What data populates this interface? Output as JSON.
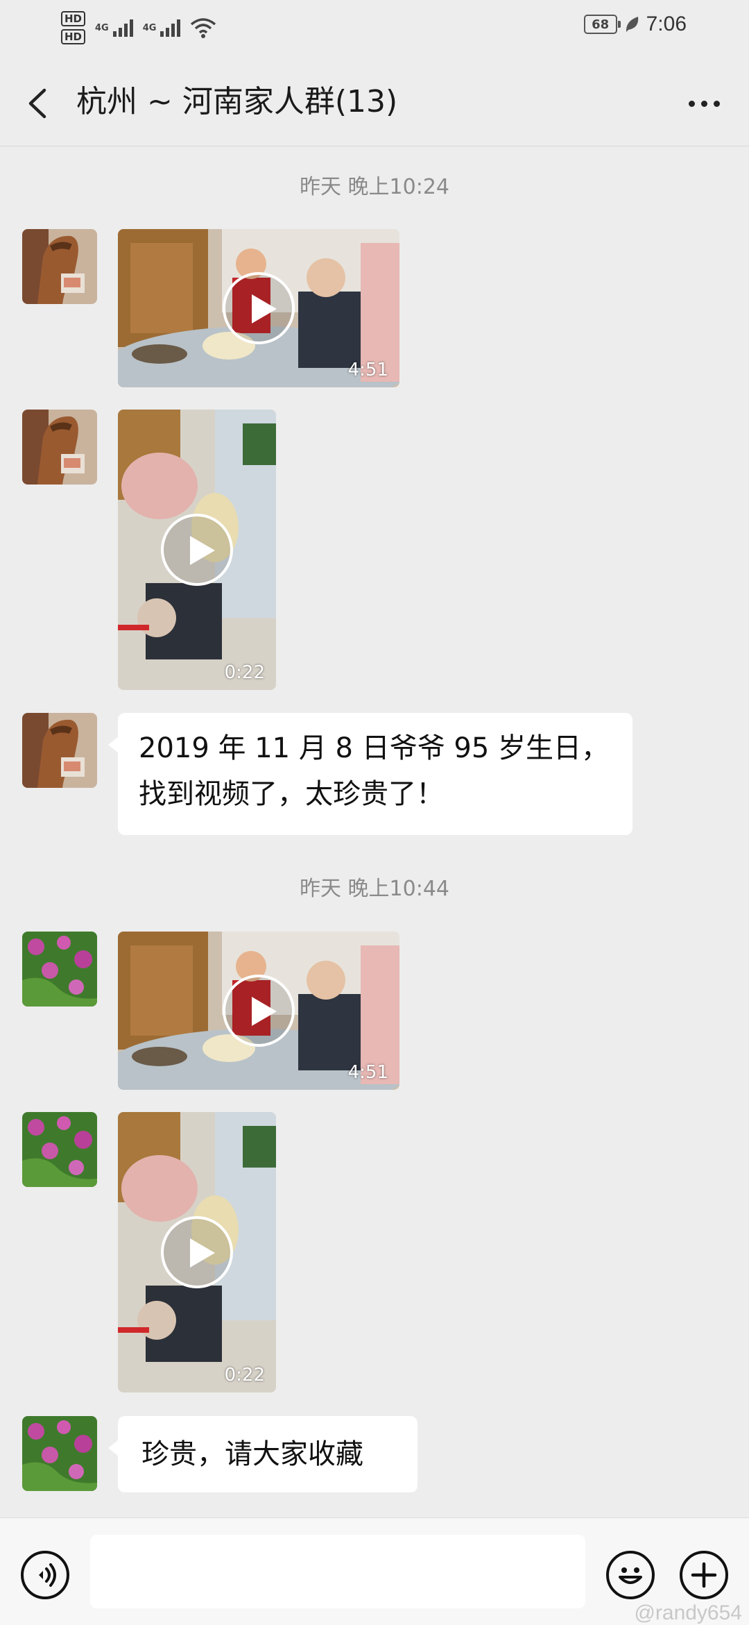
{
  "status_bar": {
    "sim1": "HD",
    "sim2": "HD",
    "net1": "4G",
    "net2": "4G",
    "battery": "68",
    "time": "7:06"
  },
  "header": {
    "title": "杭州 ~ 河南家人群(13)",
    "back_icon": "chevron-left-icon",
    "more_icon": "more-dots-icon"
  },
  "messages": {
    "timestamp1": "昨天 晚上10:24",
    "video1_duration": "4:51",
    "video2_duration": "0:22",
    "text1_line1": "2019 年 11 月 8 日爷爷 95 岁生日，",
    "text1_line2": "找到视频了，太珍贵了！",
    "timestamp2": "昨天 晚上10:44",
    "video3_duration": "4:51",
    "video4_duration": "0:22",
    "text2": "珍贵，请大家收藏"
  },
  "input_bar": {
    "voice_icon": "voice-icon",
    "emoji_icon": "emoji-icon",
    "plus_icon": "plus-icon"
  },
  "watermark": "@randy654",
  "colors": {
    "background": "#ededed",
    "bubble": "#ffffff",
    "timestamp": "#8a8a8a"
  }
}
